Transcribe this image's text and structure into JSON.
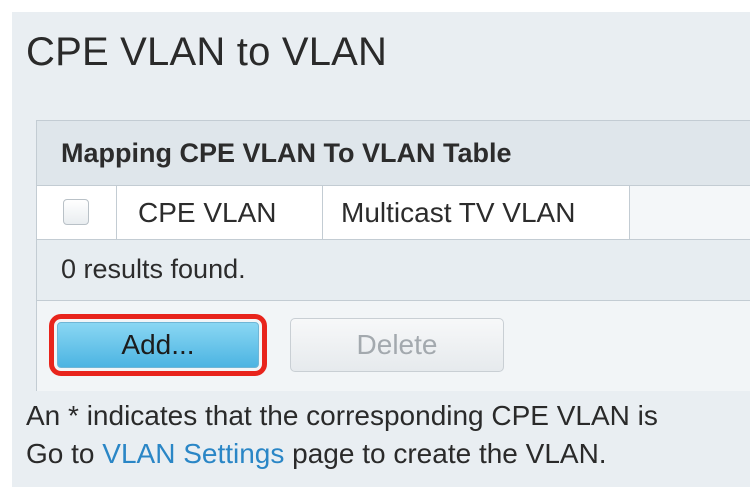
{
  "page": {
    "title": "CPE VLAN to VLAN"
  },
  "table": {
    "caption": "Mapping CPE VLAN To VLAN Table",
    "columns": [
      "CPE VLAN",
      "Multicast TV VLAN"
    ],
    "rows": [],
    "results_text": "0 results found."
  },
  "actions": {
    "add_label": "Add...",
    "delete_label": "Delete",
    "delete_enabled": false,
    "add_highlighted": true
  },
  "notes": {
    "line1": "An * indicates that the corresponding CPE VLAN is",
    "line2_prefix": "Go to ",
    "line2_link": "VLAN Settings",
    "line2_suffix": " page to create the VLAN."
  },
  "colors": {
    "background": "#e9eef2",
    "highlight": "#e8241c",
    "add_button": "#4cb4e2",
    "link": "#2a86c6"
  },
  "icons": {
    "select_all": "checkbox-icon"
  }
}
